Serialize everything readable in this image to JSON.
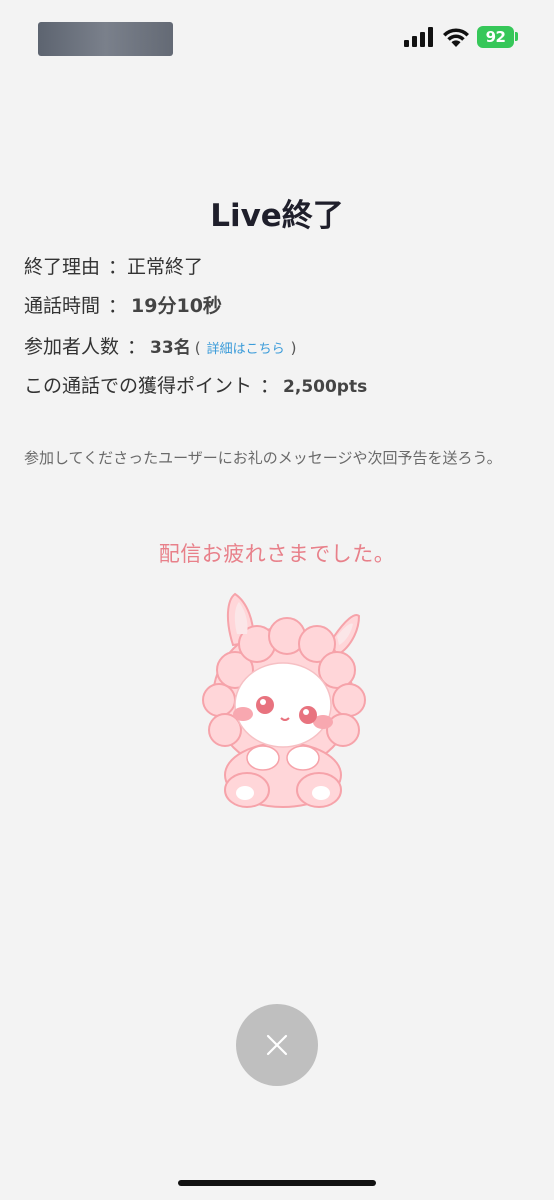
{
  "status_bar": {
    "battery": "92",
    "colors": {
      "battery": "#36c759"
    }
  },
  "title": "Live終了",
  "rows": {
    "reason": {
      "label": "終了理由",
      "colon": "：",
      "value": "正常終了"
    },
    "duration": {
      "label": "通話時間",
      "colon": "：",
      "value": "19分10秒"
    },
    "participants": {
      "label": "参加者人数",
      "colon": "：",
      "value": "33名",
      "open": "(",
      "link": "詳細はこちら",
      "close": ")"
    },
    "points": {
      "label": "この通話での獲得ポイント",
      "colon": "：",
      "value": "2,500pts"
    }
  },
  "message": "参加してくださったユーザーにお礼のメッセージや次回予告を送ろう。",
  "thanks": "配信お疲れさまでした。",
  "icons": {
    "close": "close-icon",
    "mascot": "sheep-mascot-illustration"
  },
  "colors": {
    "background": "#f3f3f3",
    "accent_pink": "#e8808a",
    "link_blue": "#3a9bd9",
    "close_button": "#bfbfbf"
  }
}
